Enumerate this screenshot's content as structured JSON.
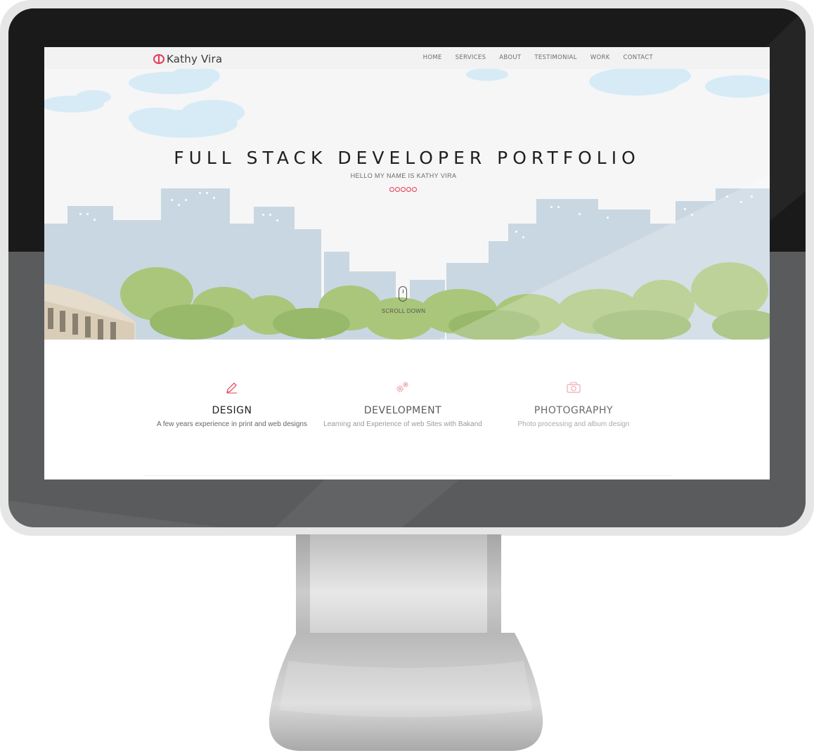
{
  "nav": {
    "logo_text": "Kathy Vira",
    "items": [
      "HOME",
      "SERVICES",
      "ABOUT",
      "TESTIMONIAL",
      "WORK",
      "CONTACT"
    ]
  },
  "hero": {
    "title": "FULL STACK DEVELOPER PORTFOLIO",
    "subtitle": "HELLO MY NAME IS KATHY VIRA",
    "scroll_label": "SCROLL DOWN"
  },
  "services": [
    {
      "title": "DESIGN",
      "description": "A few years experience in print and web designs",
      "icon": "pencil-icon"
    },
    {
      "title": "DEVELOPMENT",
      "description": "Learning and Experience of web Sites with Bakand",
      "icon": "gears-icon"
    },
    {
      "title": "PHOTOGRAPHY",
      "description": "Photo processing and album design",
      "icon": "camera-icon"
    }
  ],
  "colors": {
    "accent": "#e53b54",
    "nav_bg": "#f2f2f2",
    "bezel": "#e6e6e6"
  }
}
